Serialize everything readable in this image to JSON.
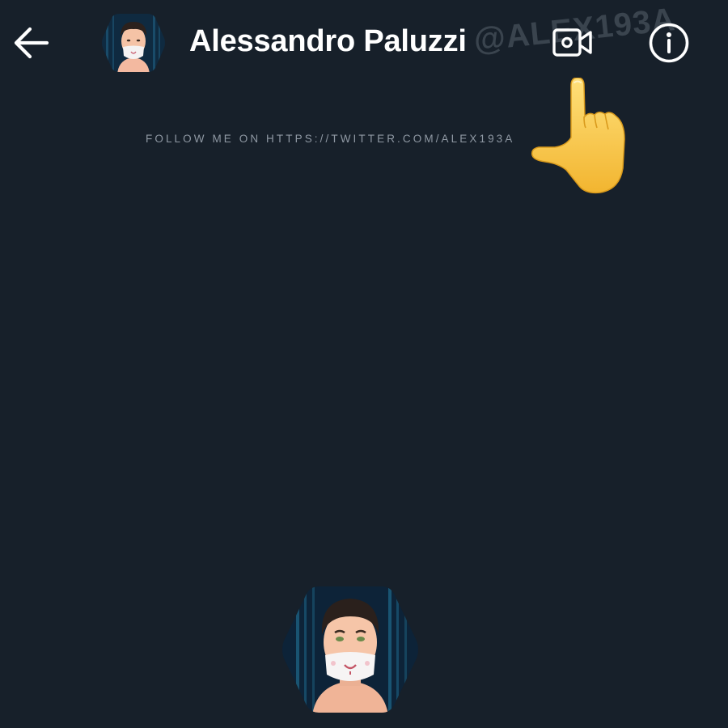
{
  "header": {
    "back_icon": "arrow-left-icon",
    "title": "Alessandro Paluzzi",
    "video_icon": "video-camera-icon",
    "info_icon": "info-circle-icon"
  },
  "watermark": "@ALEX193A",
  "follow_text": "FOLLOW ME ON HTTPS://TWITTER.COM/ALEX193A",
  "pointer_icon": "pointing-hand-icon",
  "colors": {
    "background": "#17202a",
    "text": "#ffffff",
    "muted": "#8f98a3"
  }
}
